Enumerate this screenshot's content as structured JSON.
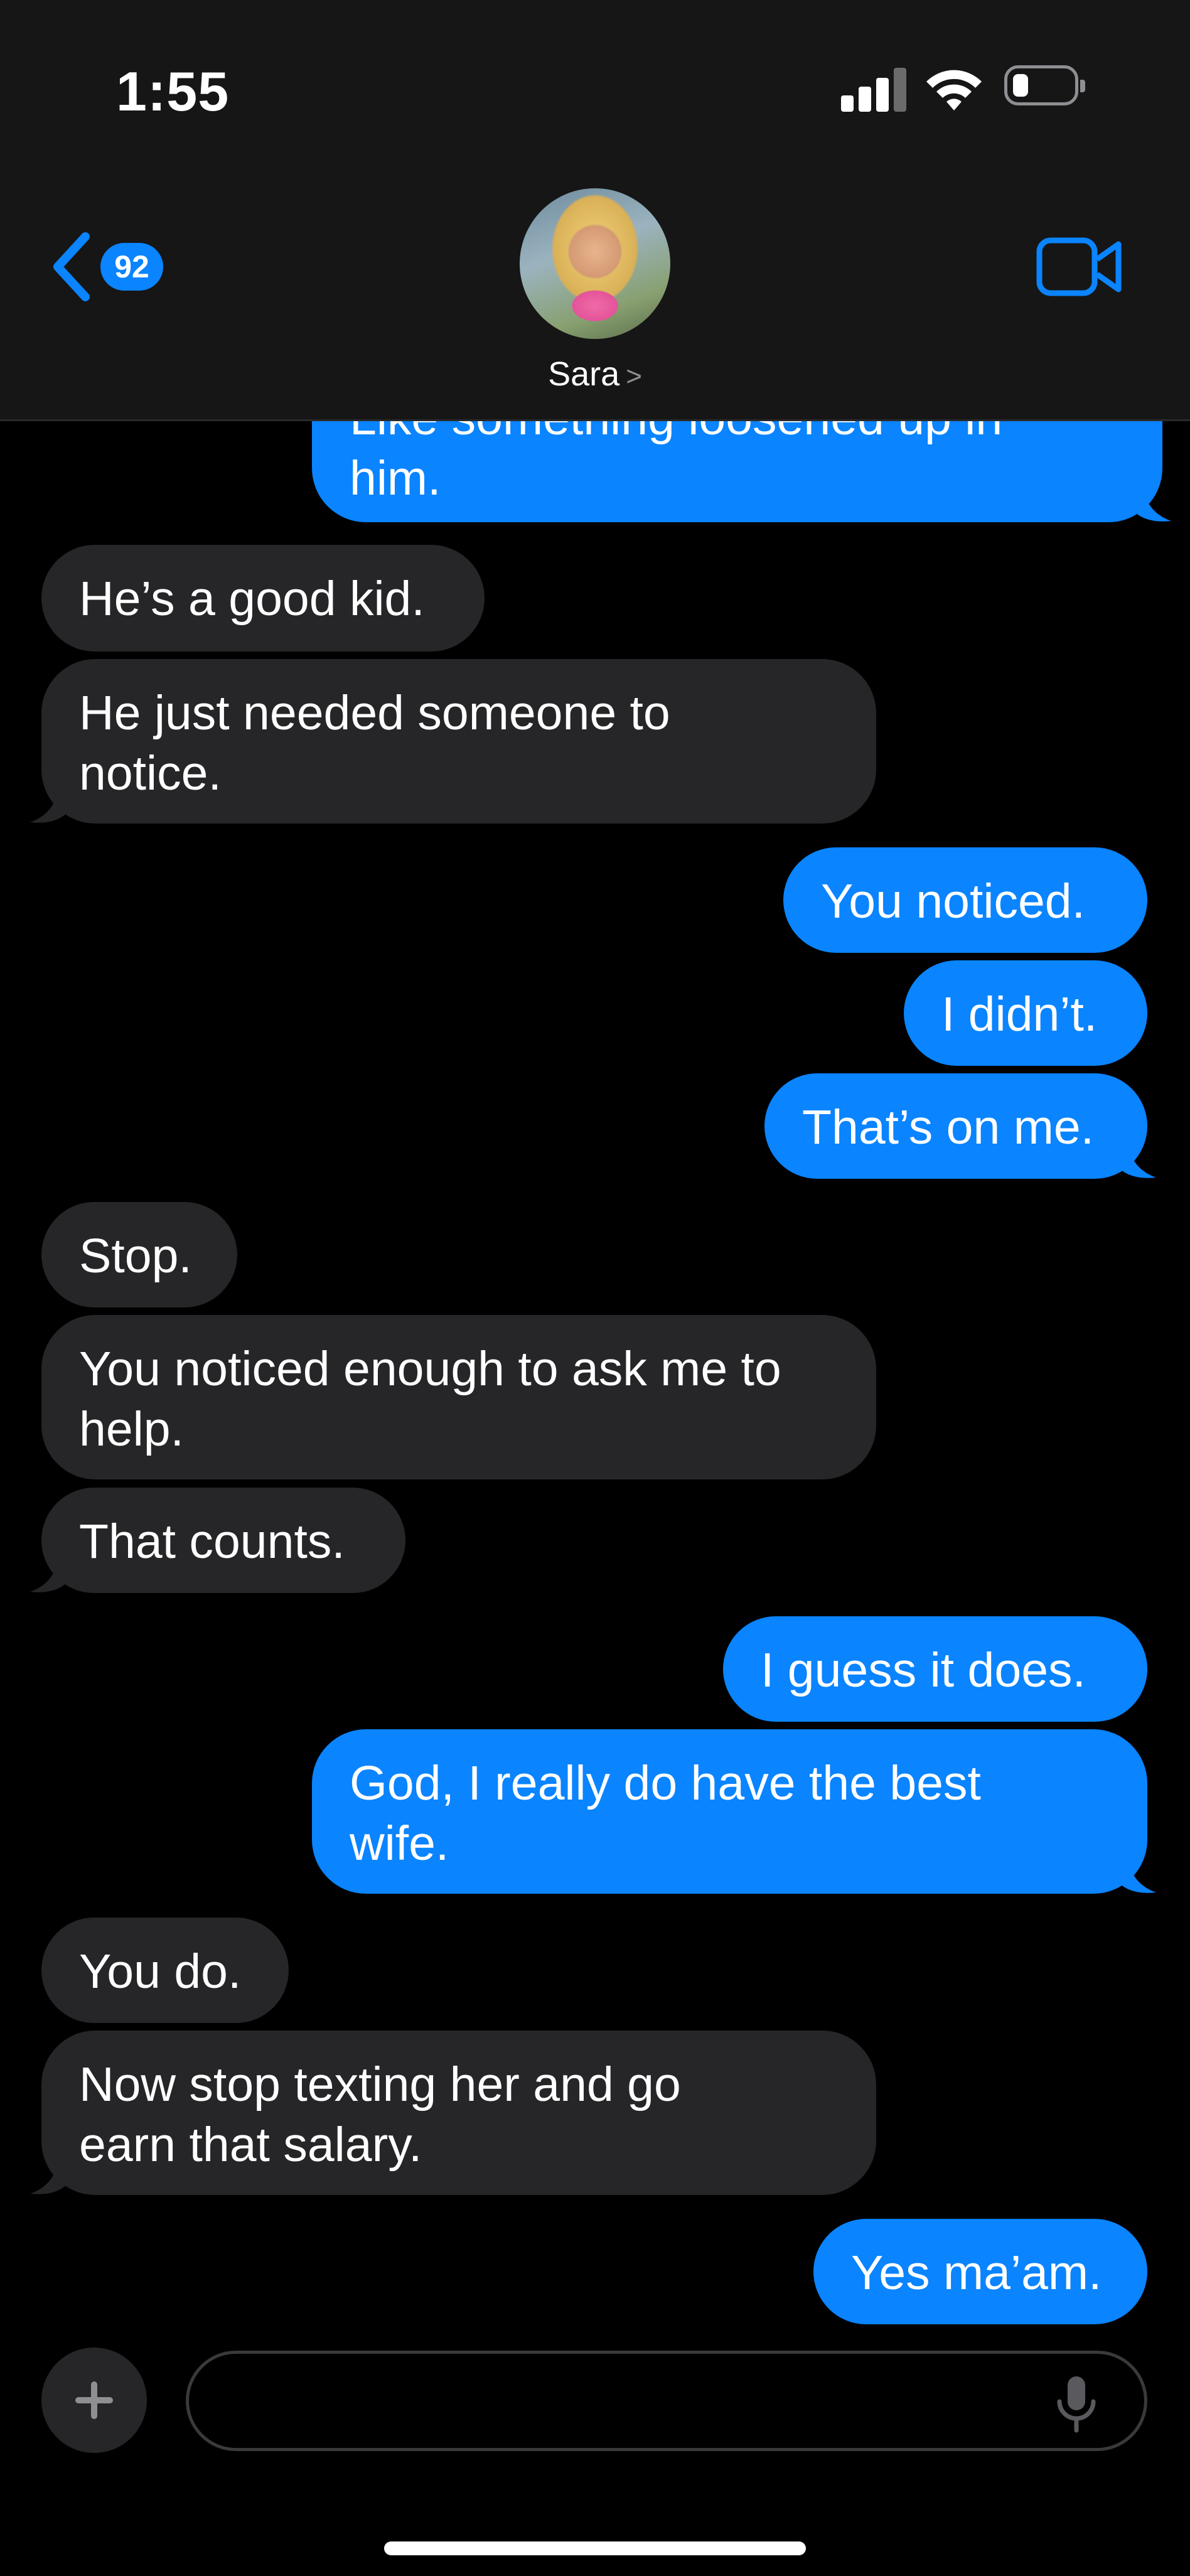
{
  "status_bar": {
    "time": "1:55"
  },
  "header": {
    "back_badge": "92",
    "contact_name": "Sara",
    "contact_chevron": ">"
  },
  "messages": [
    {
      "dir": "out",
      "text": "Like something loosened up in\nhim."
    },
    {
      "dir": "in",
      "text": "He’s a good kid."
    },
    {
      "dir": "in",
      "text": "He just needed someone to\nnotice."
    },
    {
      "dir": "out",
      "text": "You noticed."
    },
    {
      "dir": "out",
      "text": "I didn’t."
    },
    {
      "dir": "out",
      "text": "That’s on me."
    },
    {
      "dir": "in",
      "text": "Stop."
    },
    {
      "dir": "in",
      "text": "You noticed enough to ask me to\nhelp."
    },
    {
      "dir": "in",
      "text": "That counts."
    },
    {
      "dir": "out",
      "text": "I guess it does."
    },
    {
      "dir": "out",
      "text": "God, I really do have the best\nwife."
    },
    {
      "dir": "in",
      "text": "You do."
    },
    {
      "dir": "in",
      "text": "Now stop texting her and go\nearn that salary."
    },
    {
      "dir": "out",
      "text": "Yes ma’am."
    }
  ],
  "composer": {
    "value": "",
    "placeholder": ""
  },
  "colors": {
    "outgoing_bubble": "#0a84ff",
    "incoming_bubble": "#262628",
    "header_bg": "#161616",
    "accent": "#0a84ff"
  },
  "icons": {
    "back": "chevron-left-icon",
    "facetime": "video-camera-icon",
    "plus": "plus-icon",
    "mic": "microphone-icon",
    "signal": "cellular-signal-icon",
    "wifi": "wifi-icon",
    "battery": "battery-icon"
  }
}
